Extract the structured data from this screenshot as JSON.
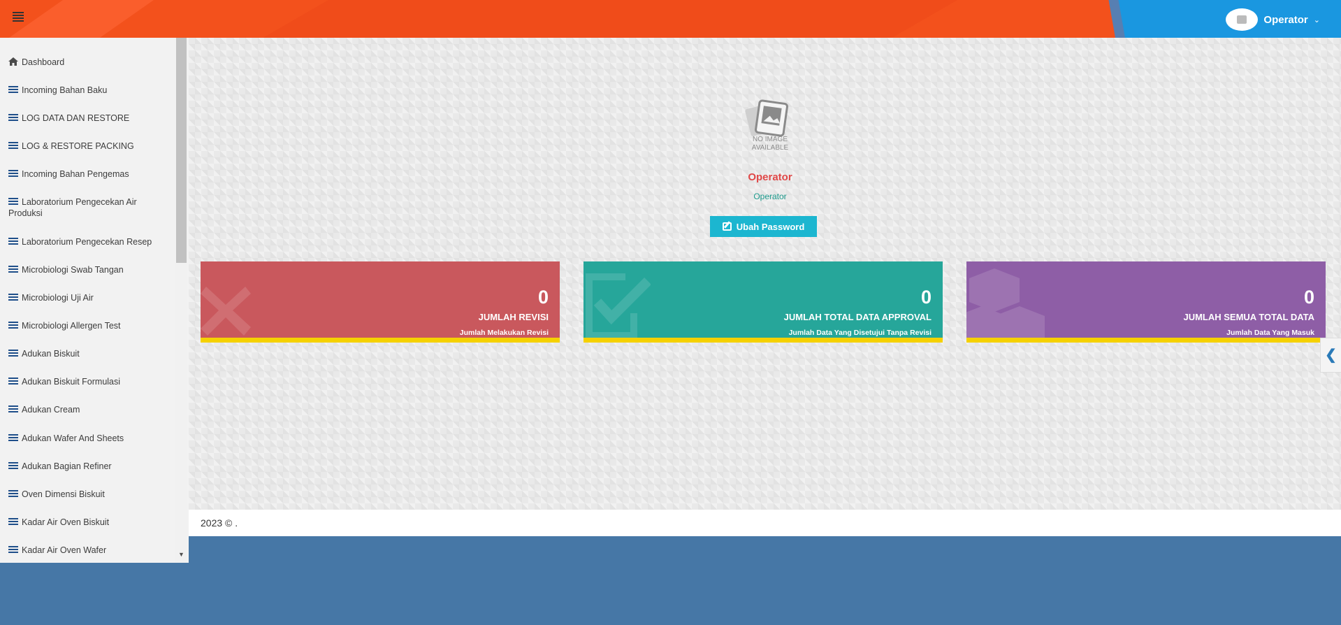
{
  "header": {
    "user_name": "Operator",
    "chevron": "⌄"
  },
  "sidebar": {
    "items": [
      {
        "label": "Dashboard",
        "icon": "home-icon"
      },
      {
        "label": "Incoming Bahan Baku",
        "icon": "list-icon"
      },
      {
        "label": "LOG DATA DAN RESTORE",
        "icon": "list-icon"
      },
      {
        "label": "LOG & RESTORE PACKING",
        "icon": "list-icon"
      },
      {
        "label": "Incoming Bahan Pengemas",
        "icon": "list-icon"
      },
      {
        "label": "Laboratorium Pengecekan Air Produksi",
        "icon": "list-icon"
      },
      {
        "label": "Laboratorium Pengecekan Resep",
        "icon": "list-icon"
      },
      {
        "label": "Microbiologi Swab Tangan",
        "icon": "list-icon"
      },
      {
        "label": "Microbiologi Uji Air",
        "icon": "list-icon"
      },
      {
        "label": "Microbiologi Allergen Test",
        "icon": "list-icon"
      },
      {
        "label": "Adukan Biskuit",
        "icon": "list-icon"
      },
      {
        "label": "Adukan Biskuit Formulasi",
        "icon": "list-icon"
      },
      {
        "label": "Adukan Cream",
        "icon": "list-icon"
      },
      {
        "label": "Adukan Wafer And Sheets",
        "icon": "list-icon"
      },
      {
        "label": "Adukan Bagian Refiner",
        "icon": "list-icon"
      },
      {
        "label": "Oven Dimensi Biskuit",
        "icon": "list-icon"
      },
      {
        "label": "Kadar Air Oven Biskuit",
        "icon": "list-icon"
      },
      {
        "label": "Kadar Air Oven Wafer",
        "icon": "list-icon"
      }
    ]
  },
  "profile": {
    "no_image_line1": "NO IMAGE",
    "no_image_line2": "AVAILABLE",
    "name": "Operator",
    "role": "Operator",
    "change_password_label": "Ubah Password"
  },
  "cards": [
    {
      "value": "0",
      "title": "JUMLAH REVISI",
      "subtitle": "Jumlah Melakukan Revisi",
      "color": "#c9585d"
    },
    {
      "value": "0",
      "title": "JUMLAH TOTAL DATA APPROVAL",
      "subtitle": "Jumlah Data Yang Disetujui Tanpa Revisi",
      "color": "#26a69a"
    },
    {
      "value": "0",
      "title": "JUMLAH SEMUA TOTAL DATA",
      "subtitle": "Jumlah Data Yang Masuk",
      "color": "#8e5ea6"
    }
  ],
  "footer": {
    "text": "2023 © ."
  },
  "side_toggle": {
    "glyph": "❮"
  }
}
